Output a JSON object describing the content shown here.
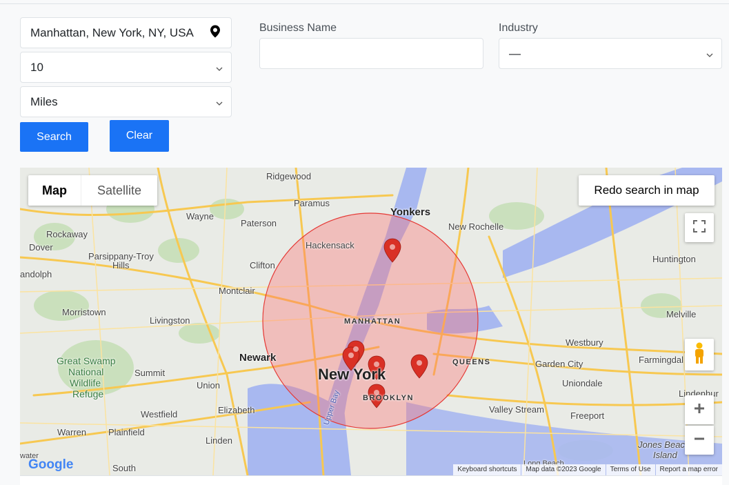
{
  "search": {
    "location_value": "Manhattan, New York, NY, USA",
    "radius_value": "10",
    "unit_value": "Miles",
    "search_label": "Search",
    "clear_label": "Clear"
  },
  "filters": {
    "business_name_label": "Business Name",
    "business_name_value": "",
    "industry_label": "Industry",
    "industry_value": "—"
  },
  "map": {
    "type_map_label": "Map",
    "type_satellite_label": "Satellite",
    "redo_label": "Redo search in map",
    "labels": {
      "ridgewood": "Ridgewood",
      "paramus": "Paramus",
      "yonkers": "Yonkers",
      "wayne": "Wayne",
      "paterson": "Paterson",
      "new_rochelle": "New Rochelle",
      "rockaway": "Rockaway",
      "dover": "Dover",
      "hackensack": "Hackensack",
      "parsippany": "Parsippany-Troy",
      "hills": "Hills",
      "clifton": "Clifton",
      "huntington": "Huntington",
      "randolph": "andolph",
      "montclair": "Montclair",
      "morristown": "Morristown",
      "livingston": "Livingston",
      "manhattan": "MANHATTAN",
      "melville": "Melville",
      "westbury": "Westbury",
      "farmingdale": "Farmingdal",
      "newark": "Newark",
      "great_swamp_1": "Great Swamp",
      "great_swamp_2": "National",
      "great_swamp_3": "Wildlife",
      "great_swamp_4": "Refuge",
      "summit": "Summit",
      "union": "Union",
      "new_york": "New York",
      "queens": "QUEENS",
      "garden_city": "Garden City",
      "uniondale": "Uniondale",
      "lindenhurst": "Lindenhur",
      "brooklyn": "BROOKLYN",
      "westfield": "Westfield",
      "elizabeth": "Elizabeth",
      "valley_stream": "Valley Stream",
      "freeport": "Freeport",
      "warren": "Warren",
      "plainfield": "Plainfield",
      "linden": "Linden",
      "upper_bay": "Upper Bay",
      "south": "South",
      "jones_beach_1": "Jones Beac",
      "jones_beach_2": "Island",
      "water": "water",
      "long_beach": "Long Beach"
    },
    "attribution": {
      "shortcuts": "Keyboard shortcuts",
      "data": "Map data ©2023 Google",
      "terms": "Terms of Use",
      "report": "Report a map error"
    },
    "google_logo": "Google",
    "colors": {
      "radius_fill": "#ff6b6b",
      "radius_stroke": "#e53935",
      "marker": "#d93025",
      "road": "#f9c74f",
      "water": "#a5b4fc"
    }
  }
}
